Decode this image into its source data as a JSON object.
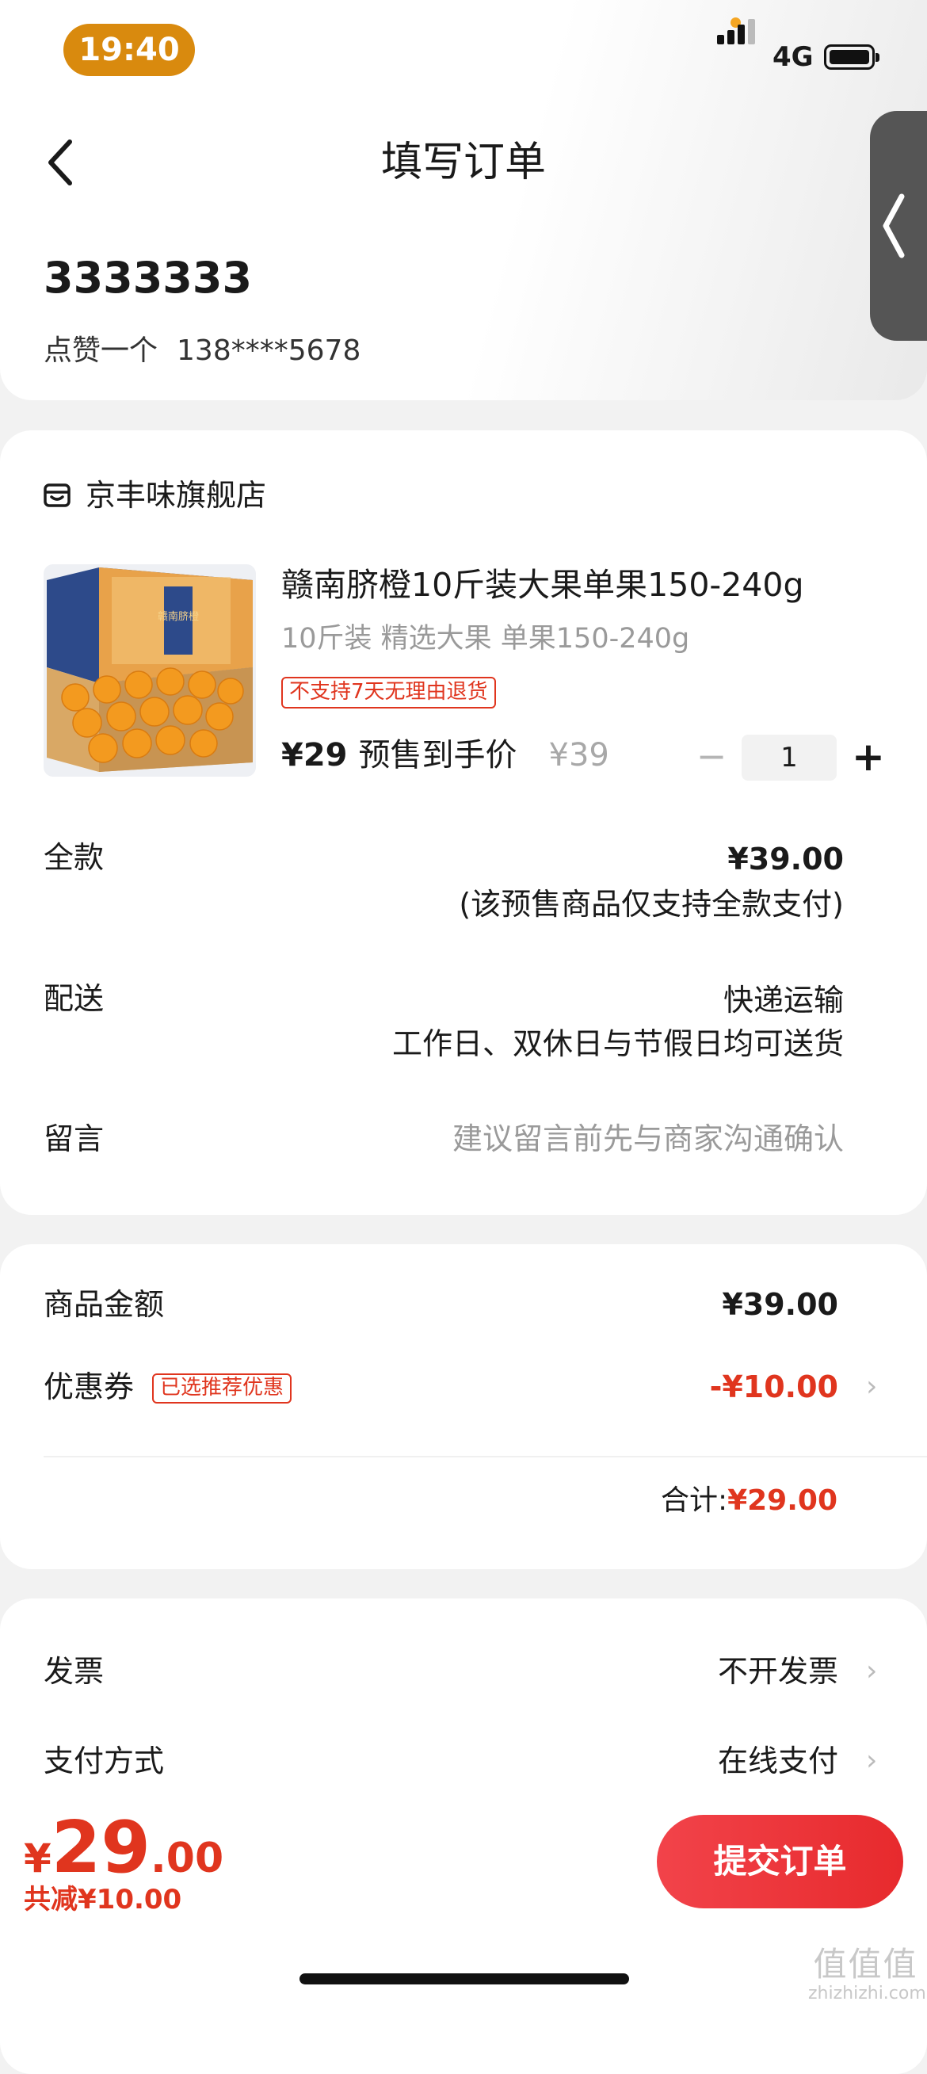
{
  "status_bar": {
    "time": "19:40",
    "network": "4G"
  },
  "header": {
    "title": "填写订单"
  },
  "recipient": {
    "name": "3333333",
    "label": "点赞一个",
    "phone": "138****5678"
  },
  "store": {
    "name": "京丰味旗舰店"
  },
  "product": {
    "title": "赣南脐橙10斤装大果单果150-240g",
    "spec": "10斤装 精选大果 单果150-240g",
    "return_badge": "不支持7天无理由退货",
    "price_now": "¥29",
    "price_label": "预售到手价",
    "price_original": "¥39",
    "quantity": "1",
    "image_box_text": "赣南脐橙"
  },
  "order_rows": {
    "full_payment_label": "全款",
    "full_payment_amount": "¥39.00",
    "full_payment_note": "(该预售商品仅支持全款支付)",
    "delivery_label": "配送",
    "delivery_method": "快递运输",
    "delivery_note": "工作日、双休日与节假日均可送货",
    "message_label": "留言",
    "message_placeholder": "建议留言前先与商家沟通确认"
  },
  "summary": {
    "goods_label": "商品金额",
    "goods_amount": "¥39.00",
    "coupon_label": "优惠券",
    "coupon_badge": "已选推荐优惠",
    "coupon_amount": "-¥10.00",
    "total_label": "合计:",
    "total_amount": "¥29.00"
  },
  "settings": {
    "invoice_label": "发票",
    "invoice_value": "不开发票",
    "payment_label": "支付方式",
    "payment_value": "在线支付"
  },
  "bottom_bar": {
    "currency": "¥",
    "price_int": "29",
    "price_dec": ".00",
    "discount_text": "共减¥10.00",
    "submit_label": "提交订单"
  },
  "watermark": {
    "logo": "值值值",
    "site": "zhizhizhi.com"
  },
  "colors": {
    "accent_red": "#e0351e",
    "time_pill": "#d98a0e",
    "button_red": "#e72a2d"
  }
}
